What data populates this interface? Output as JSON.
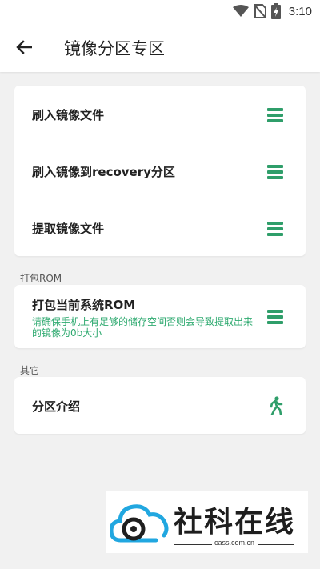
{
  "status_bar": {
    "time": "3:10",
    "icons": [
      "wifi-icon",
      "no-sim-icon",
      "battery-charging-icon"
    ]
  },
  "app_bar": {
    "title": "镜像分区专区",
    "back_icon": "arrow-back-icon"
  },
  "colors": {
    "accent": "#2f9e6a",
    "subtitle": "#2faa70",
    "background": "#f1f1f1"
  },
  "group1": {
    "items": [
      {
        "label": "刷入镜像文件",
        "icon": "menu-icon"
      },
      {
        "label": "刷入镜像到recovery分区",
        "icon": "menu-icon"
      },
      {
        "label": "提取镜像文件",
        "icon": "menu-icon"
      }
    ]
  },
  "group2": {
    "header": "打包ROM",
    "item": {
      "label": "打包当前系统ROM",
      "subtitle_line1": "请确保手机上有足够的储存空间否则会导致提取出来",
      "subtitle_line2": "的镜像为0b大小",
      "icon": "menu-icon"
    }
  },
  "group3": {
    "header": "其它",
    "item": {
      "label": "分区介绍",
      "icon": "running-person-icon"
    }
  },
  "watermark": {
    "text": "社科在线",
    "url": "cass.com.cn"
  }
}
